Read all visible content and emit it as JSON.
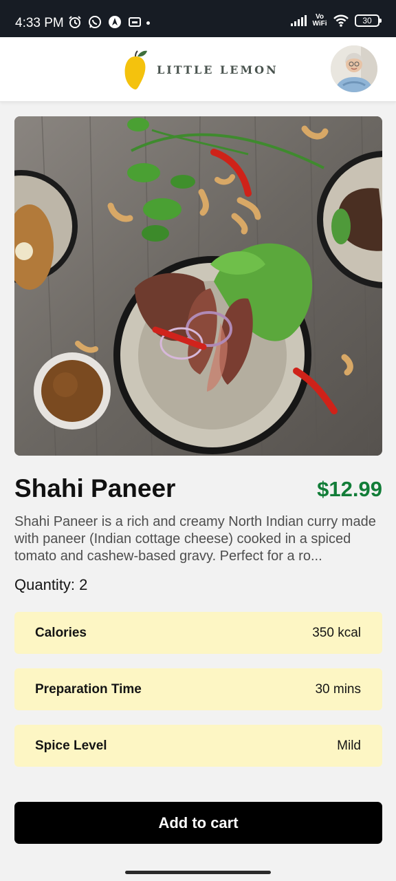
{
  "status_bar": {
    "time": "4:33 PM",
    "network_label": "Vo\nWiFi",
    "battery": "30",
    "icons": [
      "alarm-icon",
      "whatsapp-icon",
      "nav-arrow-icon",
      "voicemail-icon",
      "signal-icon",
      "wifi-icon",
      "battery-icon"
    ]
  },
  "header": {
    "brand": "LITTLE LEMON",
    "logo_icon": "lemon-icon",
    "avatar_icon": "profile-avatar"
  },
  "dish": {
    "name": "Shahi Paneer",
    "price": "$12.99",
    "description": "Shahi Paneer is a rich and creamy North Indian curry made with paneer (Indian cottage cheese) cooked in a spiced tomato and cashew-based gravy. Perfect for a ro...",
    "quantity": "Quantity: 2",
    "image_icon": "dish-photo"
  },
  "details": [
    {
      "label": "Calories",
      "value": "350 kcal"
    },
    {
      "label": "Preparation Time",
      "value": "30 mins"
    },
    {
      "label": "Spice Level",
      "value": "Mild"
    }
  ],
  "actions": {
    "add_to_cart": "Add to cart"
  },
  "colors": {
    "price": "#127d38",
    "detail_bg": "#fdf6c4",
    "button_bg": "#000000",
    "status_bar_bg": "#171c24",
    "page_bg": "#f2f2f2"
  }
}
